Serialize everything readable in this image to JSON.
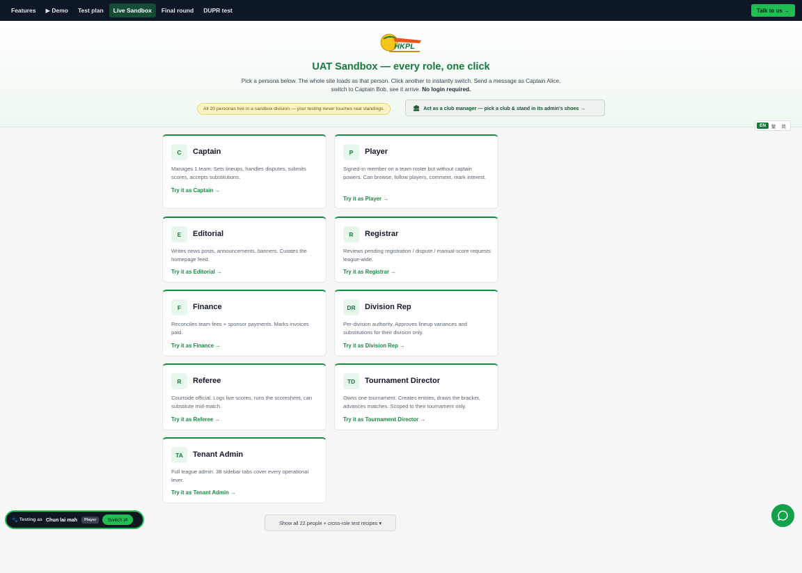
{
  "nav": {
    "items": [
      {
        "label": "Features",
        "active": false
      },
      {
        "label": "▶ Demo",
        "active": false
      },
      {
        "label": "Test plan",
        "active": false
      },
      {
        "label": "Live Sandbox",
        "active": true
      },
      {
        "label": "Final round",
        "active": false
      },
      {
        "label": "DUPR test",
        "active": false
      }
    ],
    "cta": "Talk to us →"
  },
  "hero": {
    "logo_text": "HKPL",
    "title": "UAT Sandbox — every role, one click",
    "desc_line1": "Pick a persona below. The whole site loads as that person. Click another to instantly switch. Send a message as Captain",
    "desc_line2": "Alice, switch to Captain Bob, see it arrive. ",
    "desc_bold": "No login required.",
    "note": "All 20 personas live in a sandbox division — your testing never touches real standings.",
    "club_icon": "🏛",
    "club_button": "Act as a club manager — pick a club & stand in its admin's shoes →"
  },
  "lang": {
    "en": "EN",
    "trad": "繁",
    "simp": "简"
  },
  "cards": [
    {
      "badge": "C",
      "role": "Captain",
      "desc": "Manages 1 team. Sets lineups, handles disputes, submits scores, accepts substitutions.",
      "cta": "Try it as Captain →"
    },
    {
      "badge": "P",
      "role": "Player",
      "desc": "Signed-in member on a team roster but without captain powers. Can browse, follow players, comment, mark interest.",
      "cta": "Try it as Player →"
    },
    {
      "badge": "E",
      "role": "Editorial",
      "desc": "Writes news posts, announcements, banners. Curates the homepage feed.",
      "cta": "Try it as Editorial →"
    },
    {
      "badge": "R",
      "role": "Registrar",
      "desc": "Reviews pending registration / dispute / manual-score requests league-wide.",
      "cta": "Try it as Registrar →"
    },
    {
      "badge": "F",
      "role": "Finance",
      "desc": "Reconciles team fees + sponsor payments. Marks invoices paid.",
      "cta": "Try it as Finance →"
    },
    {
      "badge": "DR",
      "role": "Division Rep",
      "desc": "Per-division authority. Approves lineup variances and substitutions for their division only.",
      "cta": "Try it as Division Rep →"
    },
    {
      "badge": "R",
      "role": "Referee",
      "desc": "Courtside official. Logs live scores, runs the scoresheet, can substitute mid-match.",
      "cta": "Try it as Referee →"
    },
    {
      "badge": "TD",
      "role": "Tournament Director",
      "desc": "Owns one tournament. Creates entries, draws the bracket, advances matches. Scoped to their tournament only.",
      "cta": "Try it as Tournament Director →"
    },
    {
      "badge": "TA",
      "role": "Tenant Admin",
      "desc": "Full league admin. 38 sidebar tabs cover every operational lever.",
      "cta": "Try it as Tenant Admin →"
    }
  ],
  "show_all": "Show all 22 people + cross-role test recipes ▾",
  "testing": {
    "icon": "🐾",
    "label": "Testing as",
    "name": "Chun lai mah",
    "role": "Player",
    "switch": "Switch ⇄"
  },
  "colors": {
    "brand": "#137a3a",
    "accent": "#1fbe55",
    "nav_bg": "#0d1726"
  }
}
